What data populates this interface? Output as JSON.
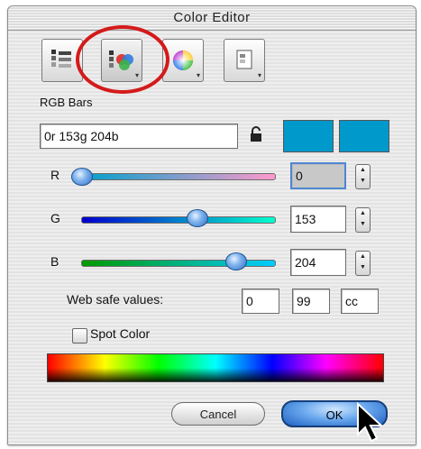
{
  "window": {
    "title": "Color Editor"
  },
  "tabs": [
    {
      "name": "sliders",
      "active": false
    },
    {
      "name": "palettes",
      "active": true
    },
    {
      "name": "color-wheel",
      "active": false
    },
    {
      "name": "swatch-book",
      "active": false
    }
  ],
  "rgb": {
    "section_label": "RGB Bars",
    "value_field": "0r 153g 204b",
    "lock_icon": "lock-icon",
    "swatch_color": "#0099cc",
    "channels": [
      {
        "label": "R",
        "value": "0",
        "fraction": 0.0
      },
      {
        "label": "G",
        "value": "153",
        "fraction": 0.6
      },
      {
        "label": "B",
        "value": "204",
        "fraction": 0.8
      }
    ]
  },
  "web_safe": {
    "label": "Web safe values:",
    "values": [
      "0",
      "99",
      "cc"
    ]
  },
  "spot_color": {
    "label": "Spot Color",
    "checked": false
  },
  "buttons": {
    "cancel": "Cancel",
    "ok": "OK"
  },
  "colors": {
    "accent": "#2d6fc7",
    "highlight_ring": "#d41a1a",
    "swatch": "#0099cc"
  }
}
